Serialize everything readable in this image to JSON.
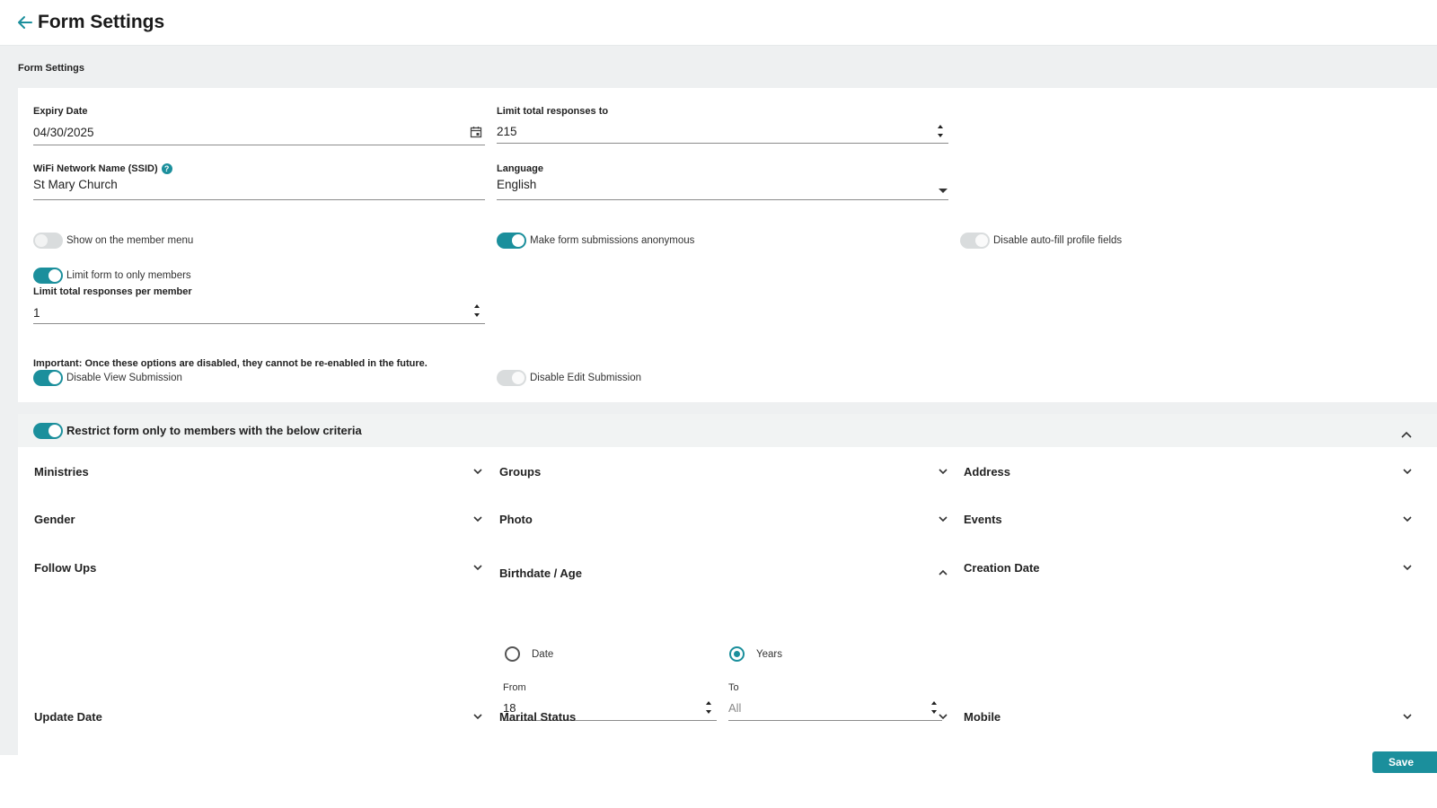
{
  "header": {
    "title": "Form Settings"
  },
  "section_label": "Form Settings",
  "fields": {
    "expiry_date": {
      "label": "Expiry Date",
      "value": "04/30/2025"
    },
    "limit_total": {
      "label": "Limit total responses to",
      "value": "215"
    },
    "ssid": {
      "label": "WiFi Network Name (SSID)",
      "value": "St Mary Church",
      "help": "?"
    },
    "language": {
      "label": "Language",
      "value": "English"
    },
    "limit_member": {
      "label": "Limit total responses per member",
      "value": "1"
    }
  },
  "toggles": {
    "show_menu": {
      "label": "Show on the member menu",
      "state": "off"
    },
    "anonymous": {
      "label": "Make form submissions anonymous",
      "state": "on"
    },
    "autofill": {
      "label": "Disable auto-fill profile fields",
      "state": "off"
    },
    "only_members": {
      "label": "Limit form to only members",
      "state": "on"
    },
    "view_submission": {
      "label": "Disable View Submission",
      "state": "on"
    },
    "edit_submission": {
      "label": "Disable Edit Submission",
      "state": "off"
    }
  },
  "important_note": "Important: Once these options are disabled, they cannot be re-enabled in the future.",
  "restrict": {
    "label": "Restrict form only to members with the below criteria",
    "state": "on"
  },
  "criteria": {
    "col1": [
      "Ministries",
      "Gender",
      "Follow Ups",
      "Update Date"
    ],
    "col2": [
      "Groups",
      "Photo",
      "Birthdate / Age",
      "Marital Status"
    ],
    "col3": [
      "Address",
      "Events",
      "Creation Date",
      "Mobile"
    ]
  },
  "birthdate": {
    "radio_date": "Date",
    "radio_years": "Years",
    "selected": "Years",
    "from_label": "From",
    "from_value": "18",
    "to_label": "To",
    "to_value": "All"
  },
  "save_label": "Save",
  "colors": {
    "accent": "#1b8f9c",
    "background": "#eef0f1"
  }
}
